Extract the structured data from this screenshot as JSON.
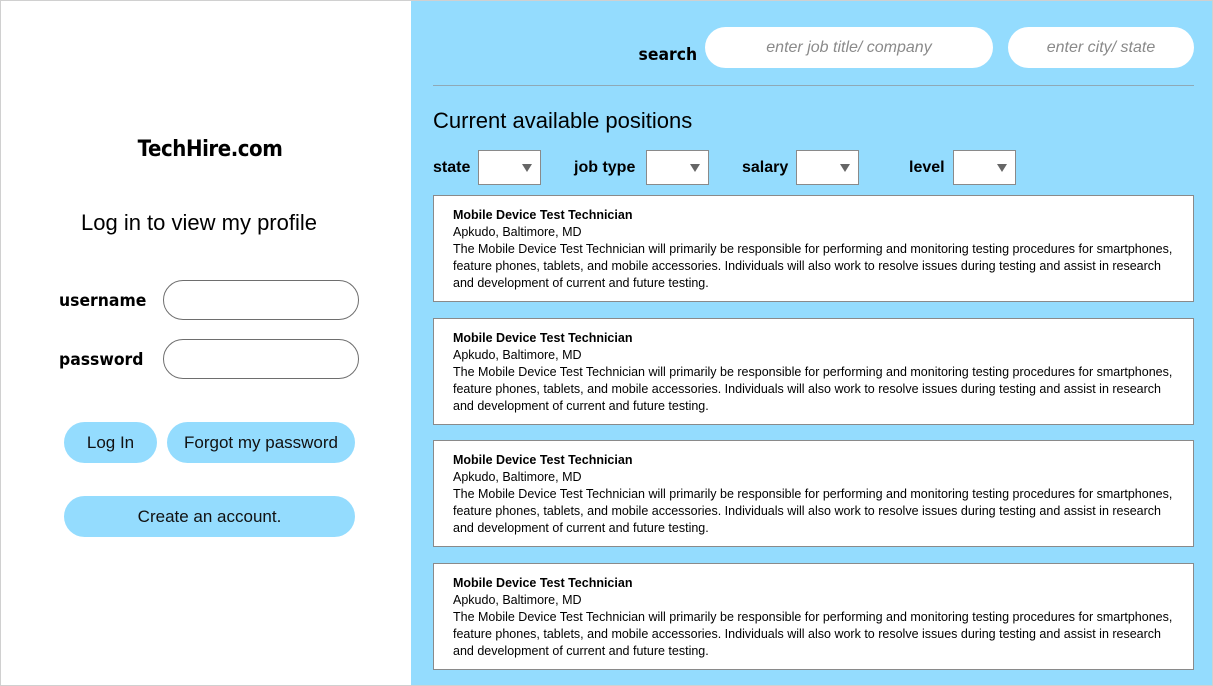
{
  "brand": "TechHire.com",
  "login": {
    "heading": "Log in to view my profile",
    "username_label": "username",
    "password_label": "password",
    "login_button": "Log In",
    "forgot_button": "Forgot my password",
    "create_button": "Create an account."
  },
  "search": {
    "label": "search",
    "job_placeholder": "enter job title/ company",
    "location_placeholder": "enter city/ state"
  },
  "section_title": "Current available positions",
  "filters": [
    {
      "label": "state"
    },
    {
      "label": "job type"
    },
    {
      "label": "salary"
    },
    {
      "label": "level"
    }
  ],
  "jobs": [
    {
      "title": "Mobile Device Test Technician",
      "location": "Apkudo, Baltimore, MD",
      "description": "The Mobile Device Test Technician will primarily be responsible for performing and monitoring testing procedures for smartphones, feature phones, tablets, and mobile accessories. Individuals will also work to resolve issues during testing and assist in research and development of current and future testing."
    },
    {
      "title": "Mobile Device Test Technician",
      "location": "Apkudo, Baltimore, MD",
      "description": "The Mobile Device Test Technician will primarily be responsible for performing and monitoring testing procedures for smartphones, feature phones, tablets, and mobile accessories. Individuals will also work to resolve issues during testing and assist in research and development of current and future testing."
    },
    {
      "title": "Mobile Device Test Technician",
      "location": "Apkudo, Baltimore, MD",
      "description": "The Mobile Device Test Technician will primarily be responsible for performing and monitoring testing procedures for smartphones, feature phones, tablets, and mobile accessories. Individuals will also work to resolve issues during testing and assist in research and development of current and future testing."
    },
    {
      "title": "Mobile Device Test Technician",
      "location": "Apkudo, Baltimore, MD",
      "description": "The Mobile Device Test Technician will primarily be responsible for performing and monitoring testing procedures for smartphones, feature phones, tablets, and mobile accessories. Individuals will also work to resolve issues during testing and assist in research and development of current and future testing."
    }
  ],
  "colors": {
    "accent": "#94dcfe",
    "panel": "#94dcfe",
    "background": "#ffffff"
  }
}
